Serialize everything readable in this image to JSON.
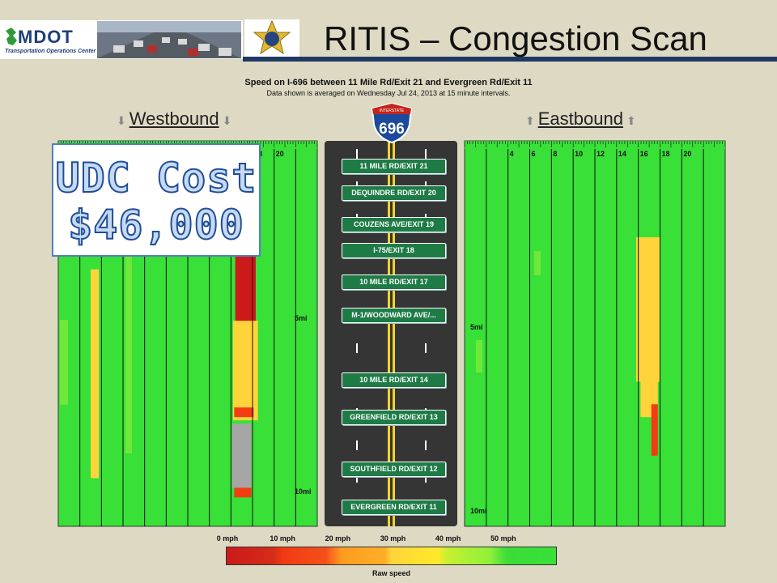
{
  "header": {
    "title": "RITIS – Congestion Scan",
    "logo_name": "MDOT",
    "logo_subtitle": "Transportation Operations Center",
    "badge_text": "MICHIGAN STATE POLICE"
  },
  "callout": {
    "line1": "UDC Cost",
    "line2": "$46,000"
  },
  "colors": {
    "title_rule": "#1f3864",
    "sign_green": "#1e7b46",
    "callout_text": "#1f4e99"
  },
  "chart_data": {
    "type": "heatmap",
    "title": "Speed on I-696 between 11 Mile Rd/Exit 21 and Evergreen Rd/Exit 11",
    "subtitle": "Data shown is averaged on Wednesday Jul 24, 2013 at 15 minute intervals.",
    "highway_shield": "696",
    "shield_label": "INTERSTATE",
    "westbound_label": "Westbound",
    "eastbound_label": "Eastbound",
    "hour_ticks": [
      "4",
      "6",
      "8",
      "10",
      "12",
      "14",
      "16",
      "18",
      "20"
    ],
    "hour_range": [
      0,
      24
    ],
    "distance_markers": [
      "5mi",
      "10mi"
    ],
    "exits": [
      "11 MILE RD/EXIT 21",
      "DEQUINDRE RD/EXIT 20",
      "COUZENS AVE/EXIT 19",
      "I-75/EXIT 18",
      "10 MILE RD/EXIT 17",
      "M-1/WOODWARD AVE/...",
      "10 MILE RD/EXIT 14",
      "GREENFIELD RD/EXIT 13",
      "SOUTHFIELD RD/EXIT 12",
      "EVERGREEN RD/EXIT 11"
    ],
    "legend": {
      "label": "Raw speed",
      "ticks": [
        "0 mph",
        "10 mph",
        "20 mph",
        "30 mph",
        "40 mph",
        "50 mph"
      ],
      "range": [
        0,
        60
      ]
    },
    "speed_scale_colors": [
      "#cc1a1a",
      "#f23d14",
      "#fd9a20",
      "#ffd43a",
      "#a6ee2e",
      "#38e038"
    ],
    "congestion_cells_mph": {
      "westbound": [
        {
          "hour_start": 3.0,
          "hour_end": 3.75,
          "mile_start": 4.0,
          "mile_end": 10.5,
          "speed": 35
        },
        {
          "hour_start": 16.4,
          "hour_end": 18.3,
          "mile_start": 3.0,
          "mile_end": 7.2,
          "speed": 8
        },
        {
          "hour_start": 16.2,
          "hour_end": 18.5,
          "mile_start": 5.6,
          "mile_end": 8.7,
          "speed": 30
        },
        {
          "hour_start": 16.3,
          "hour_end": 18.1,
          "mile_start": 8.3,
          "mile_end": 8.6,
          "speed": 12
        },
        {
          "hour_start": 16.1,
          "hour_end": 17.9,
          "mile_start": 8.8,
          "mile_end": 10.8,
          "speed": null
        },
        {
          "hour_start": 16.3,
          "hour_end": 17.9,
          "mile_start": 10.8,
          "mile_end": 11.1,
          "speed": 10
        }
      ],
      "eastbound": [
        {
          "hour_start": 15.8,
          "hour_end": 18.0,
          "mile_start": 3.0,
          "mile_end": 7.5,
          "speed": 38
        },
        {
          "hour_start": 16.2,
          "hour_end": 17.8,
          "mile_start": 5.6,
          "mile_end": 8.6,
          "speed": 30
        },
        {
          "hour_start": 17.2,
          "hour_end": 17.8,
          "mile_start": 8.2,
          "mile_end": 9.8,
          "speed": 15
        }
      ]
    }
  }
}
